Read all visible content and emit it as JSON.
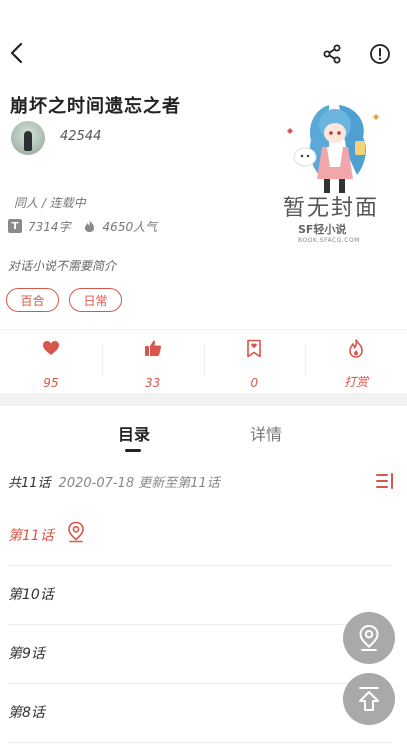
{
  "book": {
    "title": "崩坏之时间遗忘之者",
    "author": "42544",
    "category": "同人",
    "status": "连载中",
    "meta_line": "同人 / 连载中",
    "word_count": "7314字",
    "popularity": "4650人气",
    "summary": "对话小说不需要简介",
    "tags": [
      "百合",
      "日常"
    ],
    "cover": {
      "placeholder_text": "暂无封面",
      "logo_text": "SF轻小说",
      "logo_url_text": "BOOK.SFACG.COM"
    }
  },
  "stats": [
    {
      "icon": "heart-icon",
      "value": "95"
    },
    {
      "icon": "thumbs-up-icon",
      "value": "33"
    },
    {
      "icon": "ticket-icon",
      "value": "0"
    },
    {
      "icon": "flame-icon",
      "value": "打赏"
    }
  ],
  "tabs": [
    {
      "label": "目录",
      "active": true
    },
    {
      "label": "详情",
      "active": false
    }
  ],
  "catalog": {
    "total": "共11话",
    "update_text": "2020-07-18 更新至第11话",
    "chapters": [
      {
        "name": "第11话",
        "current": true
      },
      {
        "name": "第10话",
        "current": false
      },
      {
        "name": "第9话",
        "current": false
      },
      {
        "name": "第8话",
        "current": false
      }
    ]
  },
  "colors": {
    "accent": "#d9574a",
    "fab": "#a9a9a9"
  }
}
